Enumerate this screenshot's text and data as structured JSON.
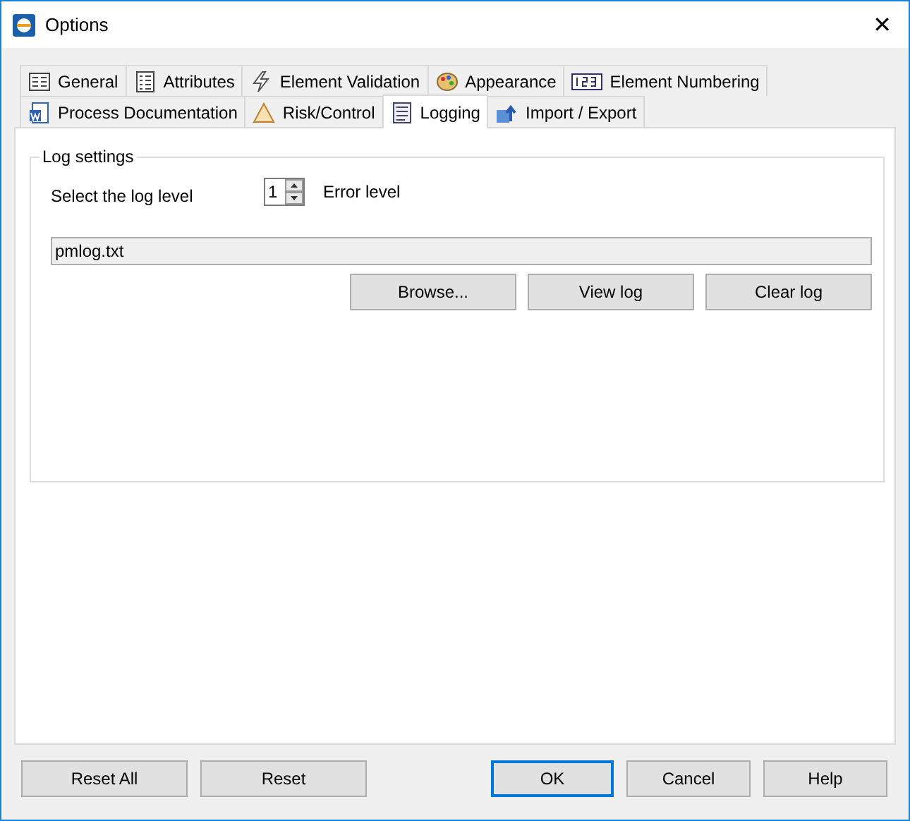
{
  "window": {
    "title": "Options",
    "close": "✕"
  },
  "tab_rows": [
    [
      {
        "label": "General",
        "selected": false
      },
      {
        "label": "Attributes",
        "selected": false
      },
      {
        "label": "Element Validation",
        "selected": false
      },
      {
        "label": "Appearance",
        "selected": false
      },
      {
        "label": "Element Numbering",
        "selected": false
      }
    ],
    [
      {
        "label": "Process Documentation",
        "selected": false
      },
      {
        "label": "Risk/Control",
        "selected": false
      },
      {
        "label": "Logging",
        "selected": true
      },
      {
        "label": "Import / Export",
        "selected": false
      }
    ]
  ],
  "log_settings": {
    "title": "Log settings",
    "level_label": "Select the log level",
    "level_value": "1",
    "level_description": "Error level",
    "file_path": "pmlog.txt",
    "buttons": [
      "Browse...",
      "View log",
      "Clear log"
    ]
  },
  "footer_buttons": [
    {
      "label": "Reset All",
      "default": false
    },
    {
      "label": "Reset",
      "default": false
    },
    {
      "label": "OK",
      "default": true
    },
    {
      "label": "Cancel",
      "default": false
    },
    {
      "label": "Help",
      "default": false
    }
  ]
}
